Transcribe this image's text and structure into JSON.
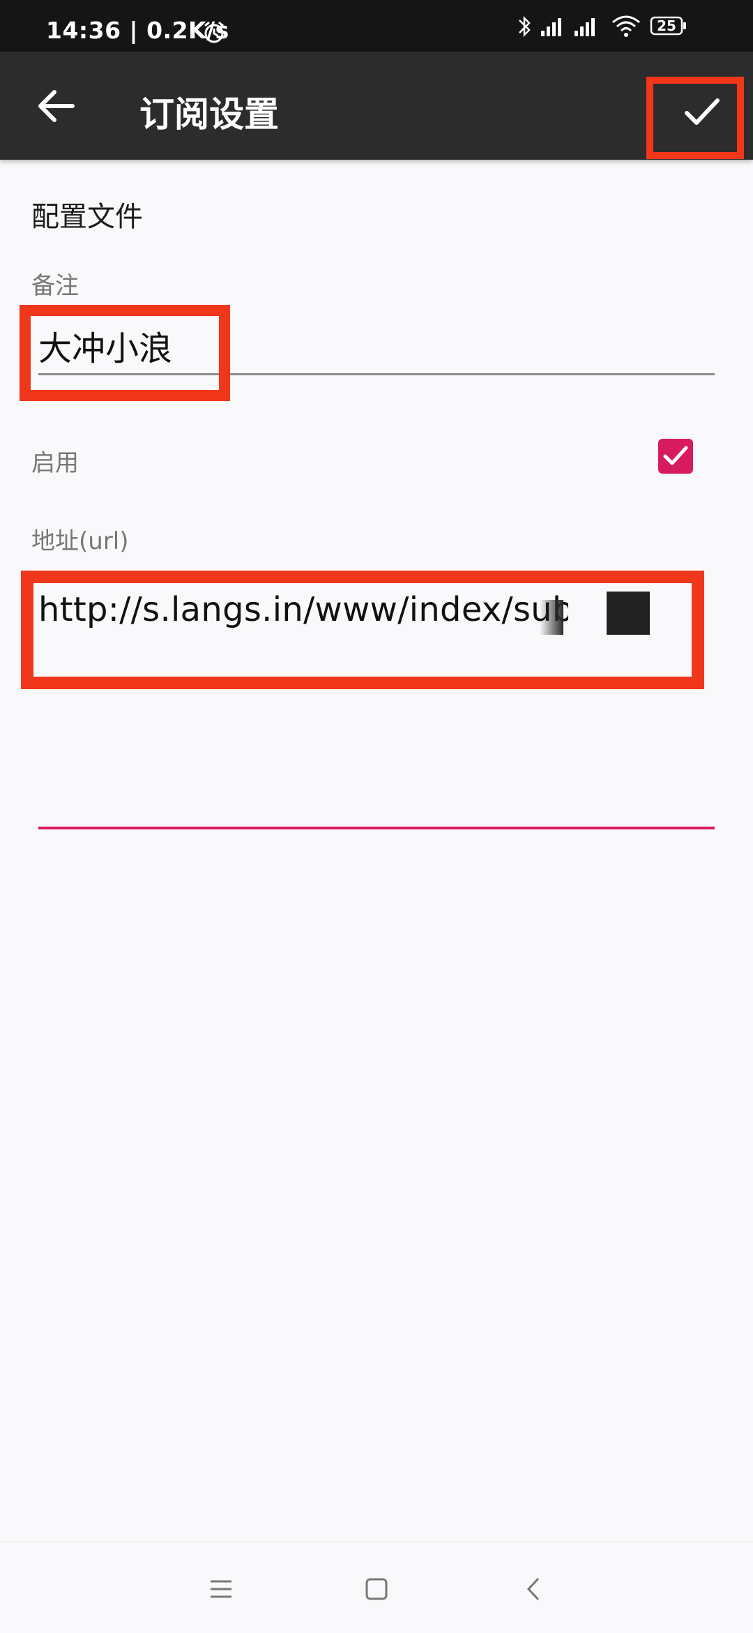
{
  "status_bar": {
    "time_speed": "14:36 | 0.2K/s",
    "battery": "25"
  },
  "app_bar": {
    "title": "订阅设置"
  },
  "form": {
    "section_title": "配置文件",
    "remark_label": "备注",
    "remark_value": "大冲小浪",
    "enable_label": "启用",
    "enabled": true,
    "url_label": "地址(url)",
    "url_value": "http://s.langs.in/www/index/sub"
  },
  "colors": {
    "accent": "#d81b60",
    "highlight": "#f0361b",
    "app_bar": "#2c2c2c",
    "status_bar": "#151515"
  }
}
